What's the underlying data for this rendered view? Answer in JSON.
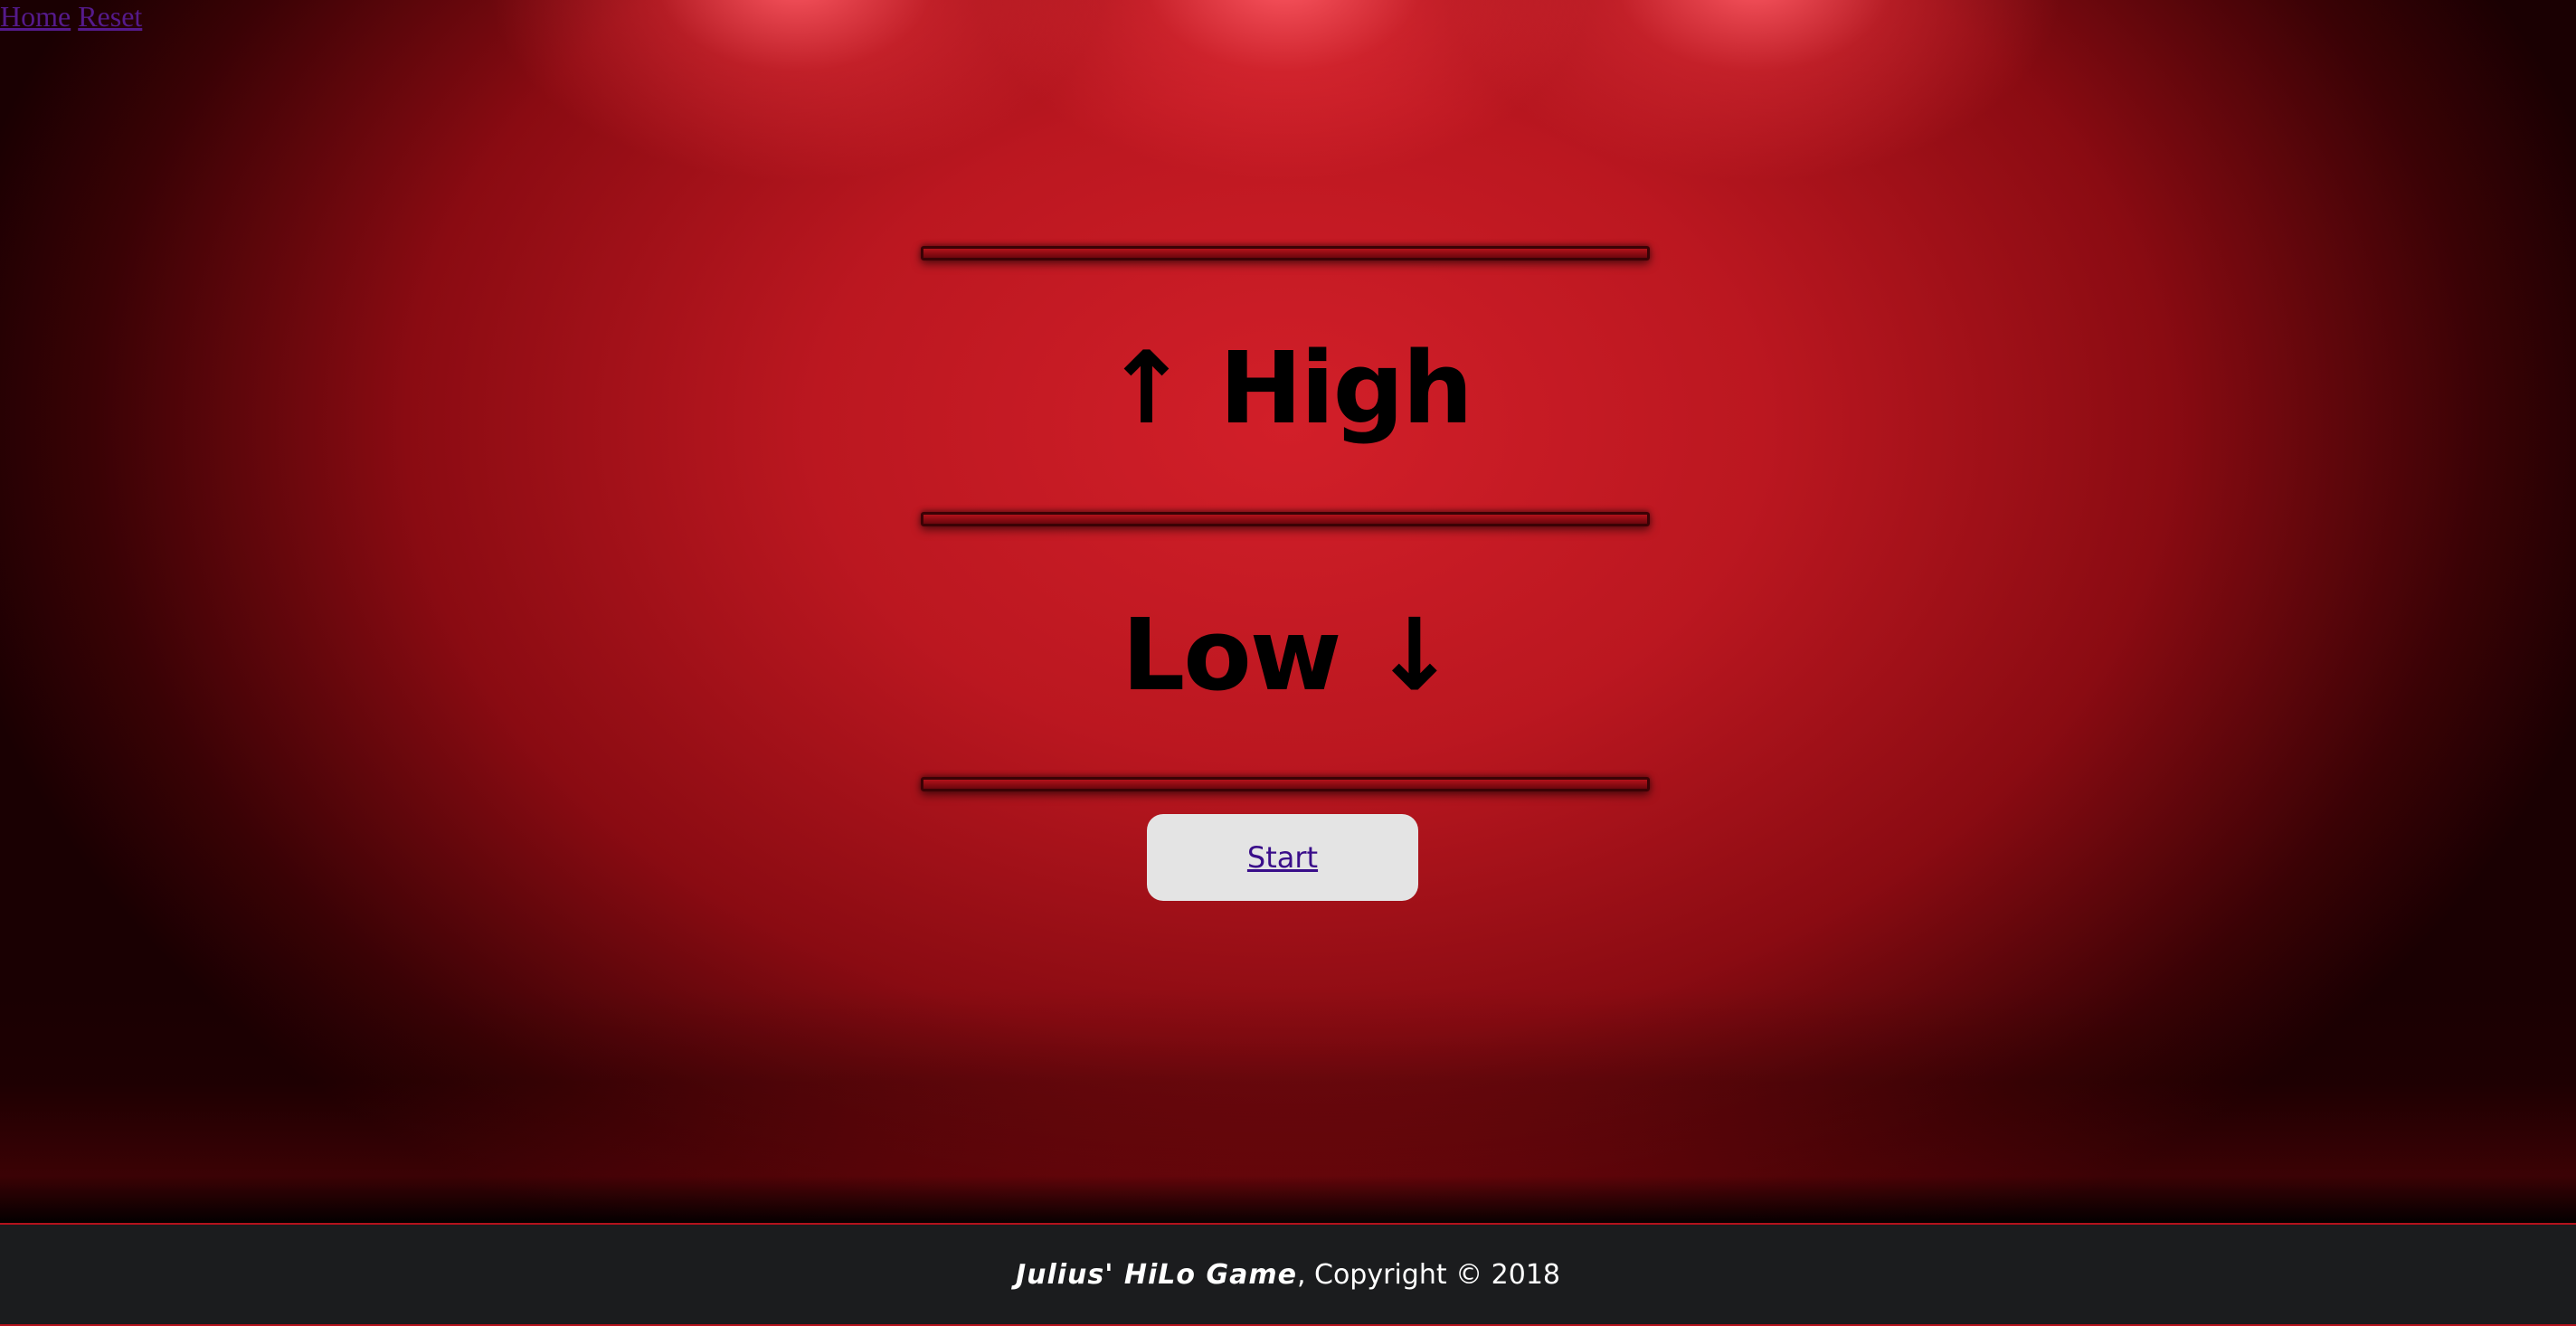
{
  "nav": {
    "home_label": "Home",
    "reset_label": "Reset"
  },
  "game": {
    "high_label": "↑ High",
    "low_label": "Low ↓",
    "start_label": "Start"
  },
  "footer": {
    "brand": "Julius' HiLo Game",
    "copyright": ", Copyright © 2018"
  },
  "colors": {
    "stage_red": "#bb1720",
    "footer_bg": "#1b1c1e",
    "footer_border": "#b3121c",
    "button_bg": "#e4e4e4",
    "link_visited": "#551a8b"
  }
}
